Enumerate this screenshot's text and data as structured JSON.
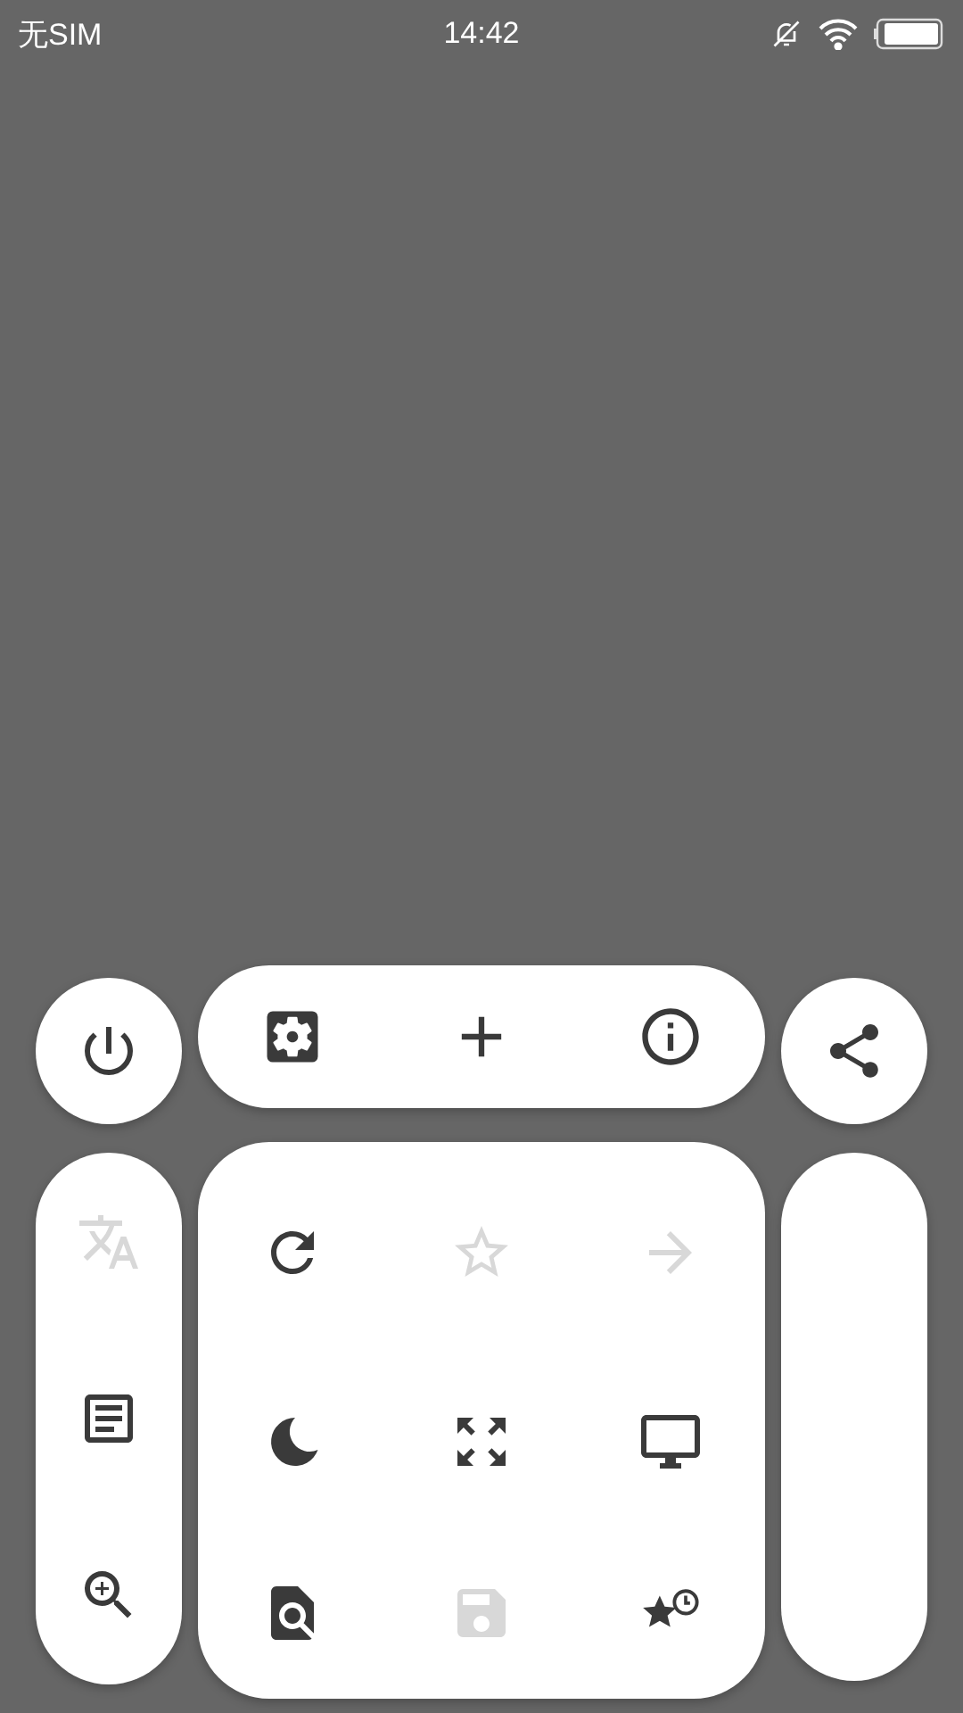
{
  "status_bar": {
    "carrier": "无SIM",
    "time": "14:42"
  },
  "menu": {
    "top_row": [
      {
        "kind": "power",
        "disabled": false
      },
      {
        "kind": "settings",
        "disabled": false
      },
      {
        "kind": "new-tab",
        "disabled": false
      },
      {
        "kind": "info",
        "disabled": false
      },
      {
        "kind": "share",
        "disabled": false
      }
    ],
    "side_column": [
      {
        "kind": "translate",
        "disabled": true
      },
      {
        "kind": "reader",
        "disabled": false
      },
      {
        "kind": "zoom",
        "disabled": false
      }
    ],
    "grid": [
      {
        "kind": "reload",
        "disabled": false
      },
      {
        "kind": "bookmark",
        "disabled": true
      },
      {
        "kind": "forward",
        "disabled": true
      },
      {
        "kind": "night",
        "disabled": false
      },
      {
        "kind": "fullscreen",
        "disabled": false
      },
      {
        "kind": "desktop",
        "disabled": false
      },
      {
        "kind": "find",
        "disabled": false
      },
      {
        "kind": "save",
        "disabled": true
      },
      {
        "kind": "history",
        "disabled": false
      }
    ]
  }
}
